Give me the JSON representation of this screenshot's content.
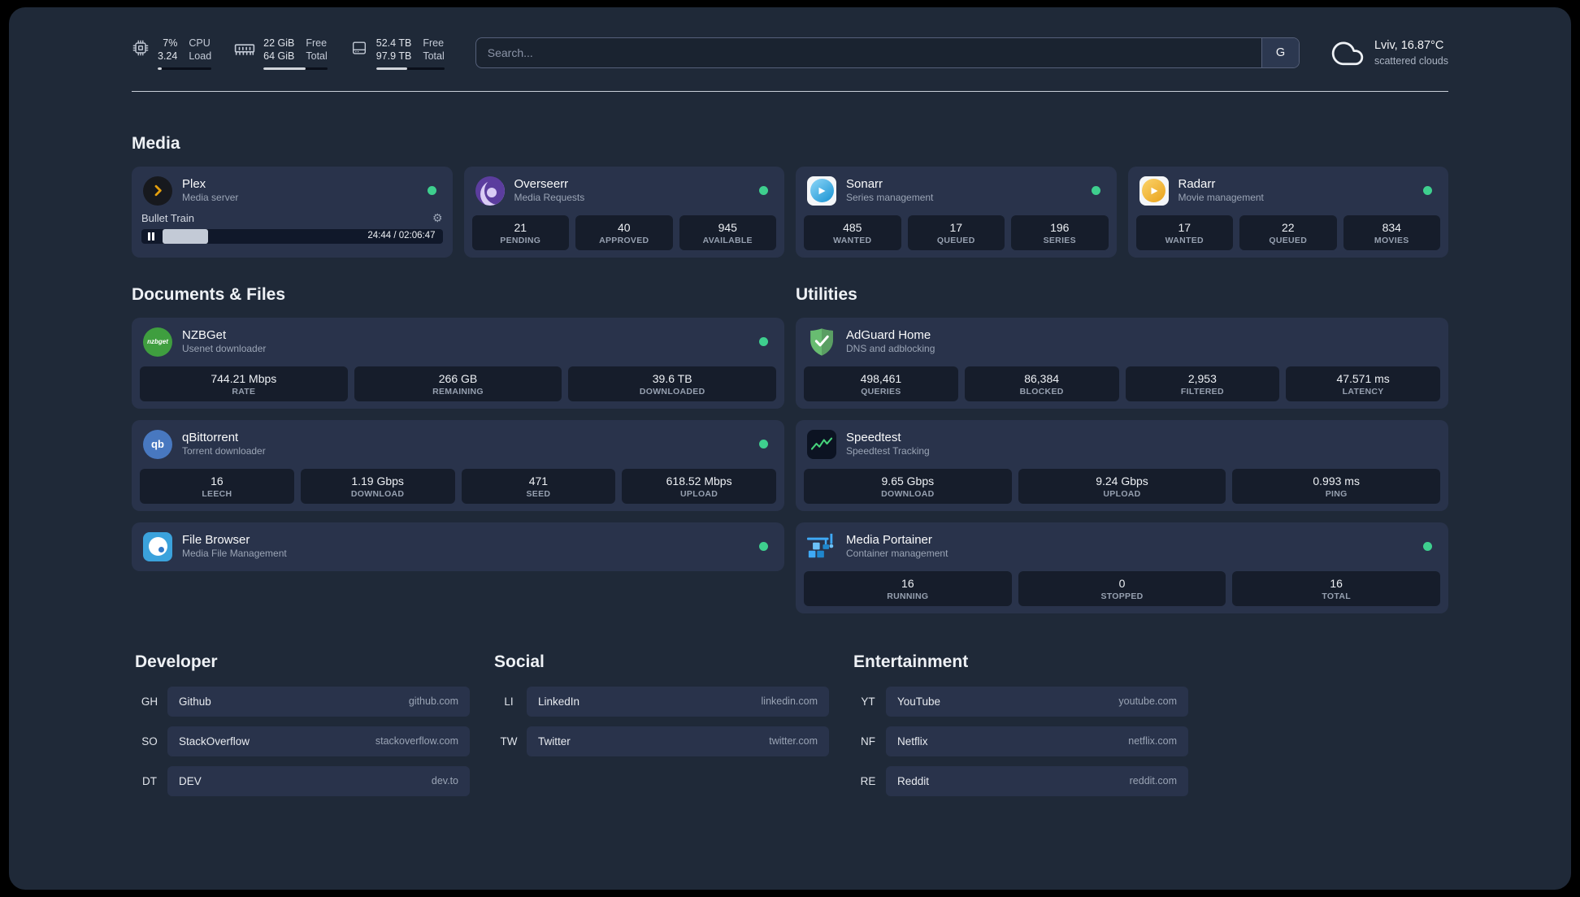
{
  "colors": {
    "status_online": "#3ecf8e",
    "panel_bg": "#1f2938",
    "card_bg": "#29334b",
    "stat_bg": "#161d2b"
  },
  "topbar": {
    "resources": [
      {
        "icon": "cpu-icon",
        "rows": [
          [
            "7%",
            "CPU"
          ],
          [
            "3.24",
            "Load"
          ]
        ],
        "bar_pct": 8
      },
      {
        "icon": "memory-icon",
        "rows": [
          [
            "22 GiB",
            "Free"
          ],
          [
            "64 GiB",
            "Total"
          ]
        ],
        "bar_pct": 66
      },
      {
        "icon": "disk-icon",
        "rows": [
          [
            "52.4 TB",
            "Free"
          ],
          [
            "97.9 TB",
            "Total"
          ]
        ],
        "bar_pct": 46
      }
    ],
    "search": {
      "placeholder": "Search...",
      "provider_label": "G"
    },
    "weather": {
      "icon": "cloud-icon",
      "location": "Lviv, 16.87°C",
      "condition": "scattered clouds"
    }
  },
  "sections": {
    "media": {
      "title": "Media",
      "services": [
        {
          "id": "plex",
          "name": "Plex",
          "subtitle": "Media server",
          "icon": "plex-icon",
          "online": true,
          "player": {
            "title": "Bullet Train",
            "time": "24:44 / 02:06:47",
            "progress_pct": 19
          }
        },
        {
          "id": "overseerr",
          "name": "Overseerr",
          "subtitle": "Media Requests",
          "icon": "overseerr-icon",
          "online": true,
          "stats": [
            {
              "value": "21",
              "label": "PENDING"
            },
            {
              "value": "40",
              "label": "APPROVED"
            },
            {
              "value": "945",
              "label": "AVAILABLE"
            }
          ]
        },
        {
          "id": "sonarr",
          "name": "Sonarr",
          "subtitle": "Series management",
          "icon": "sonarr-icon",
          "online": true,
          "stats": [
            {
              "value": "485",
              "label": "WANTED"
            },
            {
              "value": "17",
              "label": "QUEUED"
            },
            {
              "value": "196",
              "label": "SERIES"
            }
          ]
        },
        {
          "id": "radarr",
          "name": "Radarr",
          "subtitle": "Movie management",
          "icon": "radarr-icon",
          "online": true,
          "stats": [
            {
              "value": "17",
              "label": "WANTED"
            },
            {
              "value": "22",
              "label": "QUEUED"
            },
            {
              "value": "834",
              "label": "MOVIES"
            }
          ]
        }
      ]
    },
    "documents": {
      "title": "Documents & Files",
      "services": [
        {
          "id": "nzbget",
          "name": "NZBGet",
          "subtitle": "Usenet downloader",
          "icon": "nzbget-icon",
          "online": true,
          "stats": [
            {
              "value": "744.21 Mbps",
              "label": "RATE"
            },
            {
              "value": "266 GB",
              "label": "REMAINING"
            },
            {
              "value": "39.6 TB",
              "label": "DOWNLOADED"
            }
          ]
        },
        {
          "id": "qbittorrent",
          "name": "qBittorrent",
          "subtitle": "Torrent downloader",
          "icon": "qbittorrent-icon",
          "online": true,
          "stats": [
            {
              "value": "16",
              "label": "LEECH"
            },
            {
              "value": "1.19 Gbps",
              "label": "DOWNLOAD"
            },
            {
              "value": "471",
              "label": "SEED"
            },
            {
              "value": "618.52 Mbps",
              "label": "UPLOAD"
            }
          ]
        },
        {
          "id": "filebrowser",
          "name": "File Browser",
          "subtitle": "Media File Management",
          "icon": "filebrowser-icon",
          "online": true
        }
      ]
    },
    "utilities": {
      "title": "Utilities",
      "services": [
        {
          "id": "adguard",
          "name": "AdGuard Home",
          "subtitle": "DNS and adblocking",
          "icon": "adguard-icon",
          "online": false,
          "stats": [
            {
              "value": "498,461",
              "label": "QUERIES"
            },
            {
              "value": "86,384",
              "label": "BLOCKED"
            },
            {
              "value": "2,953",
              "label": "FILTERED"
            },
            {
              "value": "47.571 ms",
              "label": "LATENCY"
            }
          ]
        },
        {
          "id": "speedtest",
          "name": "Speedtest",
          "subtitle": "Speedtest Tracking",
          "icon": "speedtest-icon",
          "online": false,
          "stats": [
            {
              "value": "9.65 Gbps",
              "label": "DOWNLOAD"
            },
            {
              "value": "9.24 Gbps",
              "label": "UPLOAD"
            },
            {
              "value": "0.993 ms",
              "label": "PING"
            }
          ]
        },
        {
          "id": "portainer",
          "name": "Media Portainer",
          "subtitle": "Container management",
          "icon": "portainer-icon",
          "online": true,
          "stats": [
            {
              "value": "16",
              "label": "RUNNING"
            },
            {
              "value": "0",
              "label": "STOPPED"
            },
            {
              "value": "16",
              "label": "TOTAL"
            }
          ]
        }
      ]
    }
  },
  "bookmarks": {
    "groups": [
      {
        "id": "developer",
        "title": "Developer",
        "items": [
          {
            "abbr": "GH",
            "name": "Github",
            "url": "github.com"
          },
          {
            "abbr": "SO",
            "name": "StackOverflow",
            "url": "stackoverflow.com"
          },
          {
            "abbr": "DT",
            "name": "DEV",
            "url": "dev.to"
          }
        ]
      },
      {
        "id": "social",
        "title": "Social",
        "items": [
          {
            "abbr": "LI",
            "name": "LinkedIn",
            "url": "linkedin.com"
          },
          {
            "abbr": "TW",
            "name": "Twitter",
            "url": "twitter.com"
          }
        ]
      },
      {
        "id": "entertainment",
        "title": "Entertainment",
        "items": [
          {
            "abbr": "YT",
            "name": "YouTube",
            "url": "youtube.com"
          },
          {
            "abbr": "NF",
            "name": "Netflix",
            "url": "netflix.com"
          },
          {
            "abbr": "RE",
            "name": "Reddit",
            "url": "reddit.com"
          }
        ]
      }
    ]
  }
}
